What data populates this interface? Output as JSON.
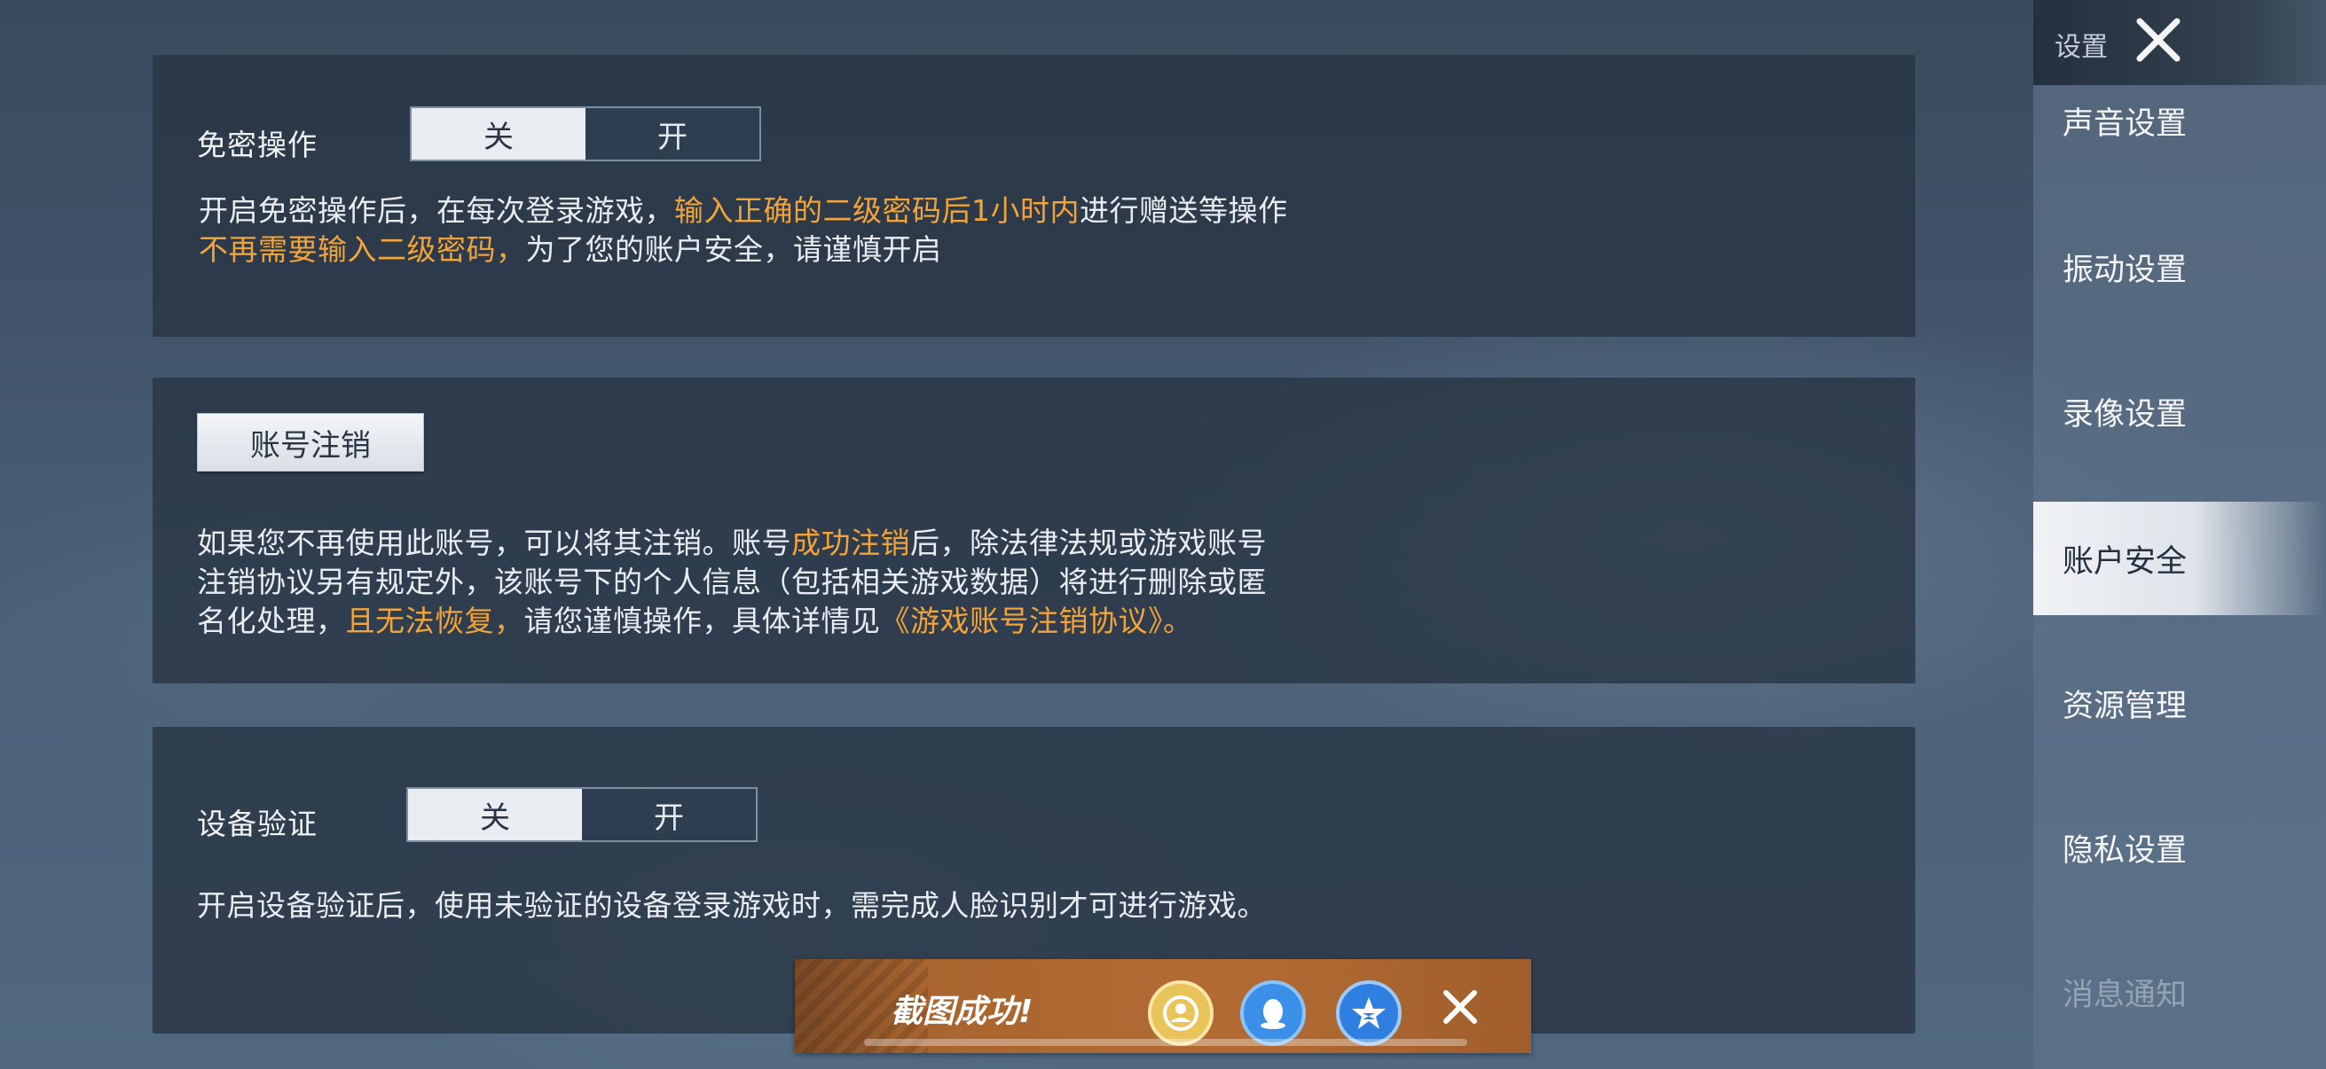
{
  "passwordless": {
    "label": "免密操作",
    "toggle_off": "关",
    "toggle_on": "开",
    "desc_line1_a": "开启免密操作后，在每次登录游戏，",
    "desc_line1_hl": "输入正确的二级密码后1小时内",
    "desc_line1_b": "进行赠送等操作",
    "desc_line2_hl": "不再需要输入二级密码，",
    "desc_line2_b": "为了您的账户安全，请谨慎开启"
  },
  "account_cancel": {
    "button_label": "账号注销",
    "desc_line1_a": "如果您不再使用此账号，可以将其注销。账号",
    "desc_line1_hl": "成功注销",
    "desc_line1_b": "后，除法律法规或游戏账号",
    "desc_line2": "注销协议另有规定外，该账号下的个人信息（包括相关游戏数据）将进行删除或匿",
    "desc_line3_a": "名化处理，",
    "desc_line3_hl": "且无法恢复，",
    "desc_line3_b": "请您谨慎操作，具体详情见",
    "desc_line3_link": "《游戏账号注销协议》。"
  },
  "device_verify": {
    "label": "设备验证",
    "toggle_off": "关",
    "toggle_on": "开",
    "desc": "开启设备验证后，使用未验证的设备登录游戏时，需完成人脸识别才可进行游戏。"
  },
  "sidebar": {
    "title": "设置",
    "items": [
      {
        "label": "声音设置"
      },
      {
        "label": "振动设置"
      },
      {
        "label": "录像设置"
      },
      {
        "label": "账户安全"
      },
      {
        "label": "资源管理"
      },
      {
        "label": "隐私设置"
      },
      {
        "label": "消息通知"
      }
    ]
  },
  "toast": {
    "text": "截图成功!"
  },
  "colors": {
    "highlight": "#f2a43a",
    "active_toggle": "#e9edf2",
    "panel": "#28344a"
  }
}
